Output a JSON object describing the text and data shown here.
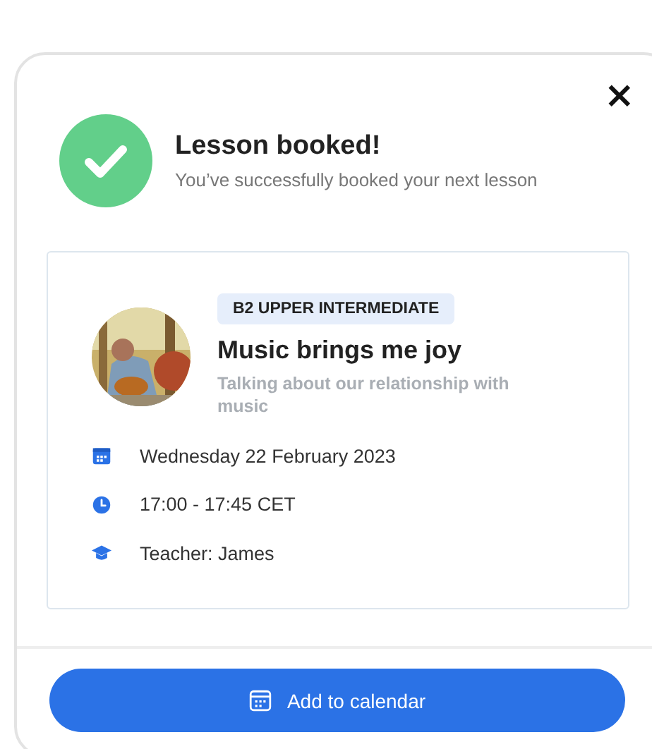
{
  "dialog": {
    "close": "×",
    "title": "Lesson booked!",
    "subtitle": "You’ve successfully booked your next lesson"
  },
  "lesson": {
    "level": "B2 UPPER INTERMEDIATE",
    "title": "Music brings me joy",
    "description": "Talking about our relationship with music",
    "details": [
      {
        "kind": "date",
        "text": "Wednesday 22 February 2023"
      },
      {
        "kind": "time",
        "text": "17:00 - 17:45 CET"
      },
      {
        "kind": "teacher",
        "text": "Teacher: James"
      }
    ]
  },
  "action": {
    "label": "Add to calendar"
  }
}
